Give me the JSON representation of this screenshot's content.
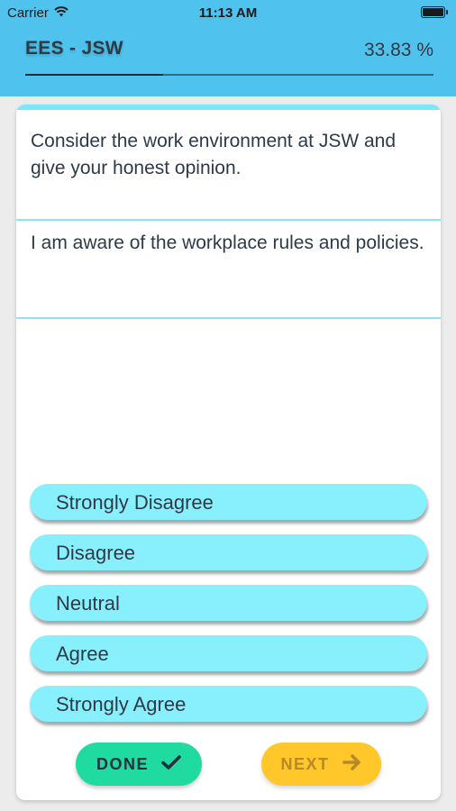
{
  "status_bar": {
    "carrier": "Carrier",
    "time": "11:13 AM"
  },
  "header": {
    "title": "EES - JSW",
    "percent_label": "33.83 %",
    "progress_fraction": 0.3383
  },
  "card": {
    "instruction": "Consider the work environment at JSW and give your honest opinion.",
    "question": "I am aware of the workplace rules and policies."
  },
  "options": [
    {
      "label": "Strongly Disagree"
    },
    {
      "label": "Disagree"
    },
    {
      "label": "Neutral"
    },
    {
      "label": "Agree"
    },
    {
      "label": "Strongly Agree"
    }
  ],
  "actions": {
    "done_label": "DONE",
    "next_label": "NEXT"
  },
  "icons": {
    "done": "check-icon",
    "next": "arrow-right-icon",
    "wifi": "wifi-icon",
    "battery": "battery-icon"
  },
  "colors": {
    "header": "#4fc3ee",
    "option": "#88f0fd",
    "done": "#20dba0",
    "next": "#ffc72a"
  }
}
